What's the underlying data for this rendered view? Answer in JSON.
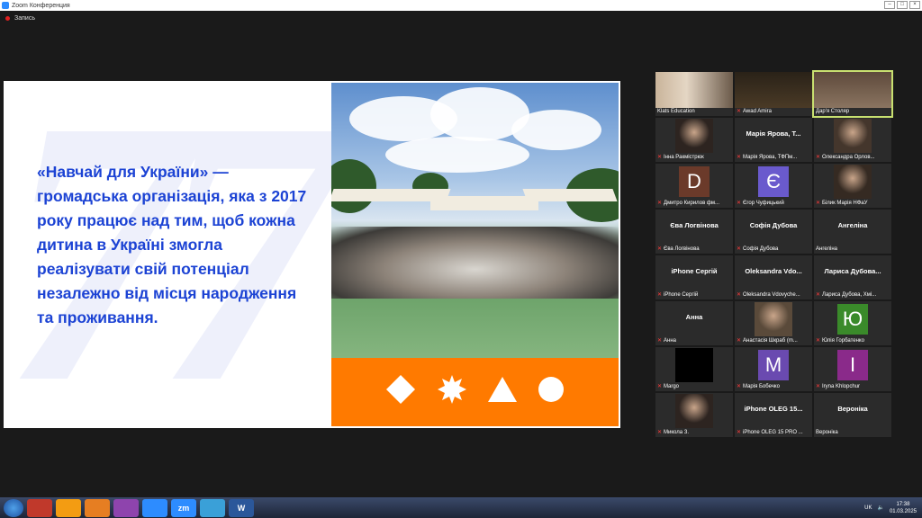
{
  "window": {
    "title": "Zoom Конференция"
  },
  "recording": {
    "label": "Запись"
  },
  "slide": {
    "text": "«Навчай для України» — громадська організація, яка з 2017 року працює над тим, щоб кожна дитина в Україні змогла реалізувати свій потенціал незалежно від місця народження та проживання.",
    "watermark": "77",
    "band_color": "#ff7a00"
  },
  "participants": [
    {
      "center": "",
      "name": "Klats Education",
      "type": "video",
      "muted": false
    },
    {
      "center": "",
      "name": "Awad Amira",
      "type": "video",
      "muted": true
    },
    {
      "center": "",
      "name": "Дар'я Столяр",
      "type": "video",
      "muted": false,
      "active": true
    },
    {
      "center": "",
      "name": "Інна Ракмістрюк",
      "type": "photo",
      "muted": true
    },
    {
      "center": "Марія Ярова, Т...",
      "name": "Марія Ярова, ТФПм...",
      "type": "text",
      "muted": true
    },
    {
      "center": "",
      "name": "Олександра Орлов...",
      "type": "photo",
      "muted": true
    },
    {
      "center": "D",
      "name": "Дмитро Кирилов фм...",
      "type": "letter",
      "color": "#6b3a2a",
      "muted": true
    },
    {
      "center": "Є",
      "name": "Єгор Чуфицький",
      "type": "letter",
      "color": "#6a5acd",
      "muted": true
    },
    {
      "center": "",
      "name": "Білик Марія НФаУ",
      "type": "photo",
      "muted": true
    },
    {
      "center": "Єва Логвінова",
      "name": "Єва Логвінова",
      "type": "text",
      "muted": true
    },
    {
      "center": "Софія Дубова",
      "name": "Софія Дубова",
      "type": "text",
      "muted": true
    },
    {
      "center": "Ангеліна",
      "name": "Ангеліна",
      "type": "text",
      "muted": false
    },
    {
      "center": "iPhone Сергій",
      "name": "iPhone Сергій",
      "type": "text",
      "muted": true
    },
    {
      "center": "Oleksandra Vdo...",
      "name": "Oleksandra Vdovyche...",
      "type": "text",
      "muted": true
    },
    {
      "center": "Лариса Дубова...",
      "name": "Лариса Дубова, Хмі...",
      "type": "text",
      "muted": true
    },
    {
      "center": "Анна",
      "name": "Анна",
      "type": "text",
      "muted": true
    },
    {
      "center": "",
      "name": "Анастасія Шкраб (m...",
      "type": "photo",
      "muted": true
    },
    {
      "center": "Ю",
      "name": "Юлія Горбатенко",
      "type": "letter",
      "color": "#3a8a2a",
      "muted": true
    },
    {
      "center": "",
      "name": "Margo",
      "type": "black",
      "muted": true
    },
    {
      "center": "M",
      "name": "Марія Бобечко",
      "type": "letter",
      "color": "#6a4ab0",
      "muted": true
    },
    {
      "center": "I",
      "name": "Iryna Khlopchur",
      "type": "letter",
      "color": "#8a2a8a",
      "muted": true
    },
    {
      "center": "",
      "name": "Микола З.",
      "type": "photo",
      "muted": true
    },
    {
      "center": "iPhone OLEG 15...",
      "name": "iPhone OLEG 15 PRO ...",
      "type": "text",
      "muted": true
    },
    {
      "center": "Вероніка",
      "name": "Вероніка",
      "type": "text",
      "muted": false
    }
  ],
  "taskbar": {
    "apps": [
      "",
      "",
      "",
      "",
      "",
      "zm",
      "",
      "W"
    ],
    "lang": "UK",
    "time": "17:38",
    "date": "01.03.2025"
  }
}
